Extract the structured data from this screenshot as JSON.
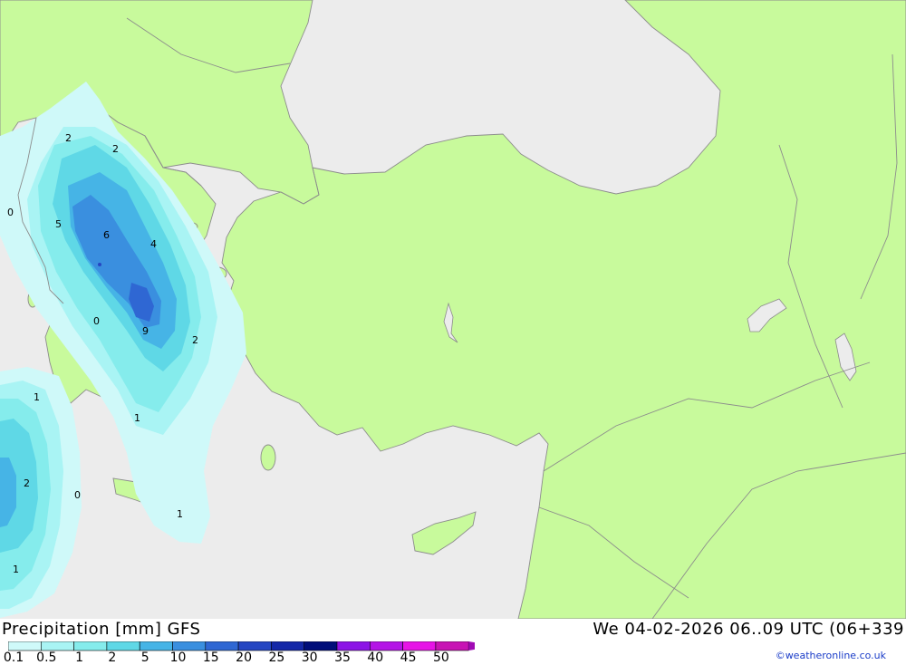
{
  "title": "Precipitation [mm] GFS",
  "datetime": "We 04-02-2026 06..09 UTC (06+339",
  "credit": "©weatheronline.co.uk",
  "colors": {
    "sea": "#ececec",
    "land": "#c8fa9c",
    "border": "#8c8c8c"
  },
  "legend": [
    {
      "label": "0.1",
      "color": "#cff9f9"
    },
    {
      "label": "0.5",
      "color": "#a9f4f4"
    },
    {
      "label": "1",
      "color": "#85ecec"
    },
    {
      "label": "2",
      "color": "#5fd8e6"
    },
    {
      "label": "5",
      "color": "#46b4e6"
    },
    {
      "label": "10",
      "color": "#3a8fdf"
    },
    {
      "label": "15",
      "color": "#2f67d3"
    },
    {
      "label": "20",
      "color": "#2546c2"
    },
    {
      "label": "25",
      "color": "#1428a8"
    },
    {
      "label": "30",
      "color": "#000e7a"
    },
    {
      "label": "35",
      "color": "#8c14e6"
    },
    {
      "label": "40",
      "color": "#b414e6"
    },
    {
      "label": "45",
      "color": "#e614e6"
    },
    {
      "label": "50",
      "color": "#c814b4"
    }
  ],
  "legend_overflow_color": "#a00ab4",
  "contour_labels": [
    "2",
    "2",
    "0",
    "5",
    "6",
    "4",
    "0",
    "9",
    "2",
    "1",
    "1",
    "2",
    "0",
    "1",
    "1"
  ]
}
